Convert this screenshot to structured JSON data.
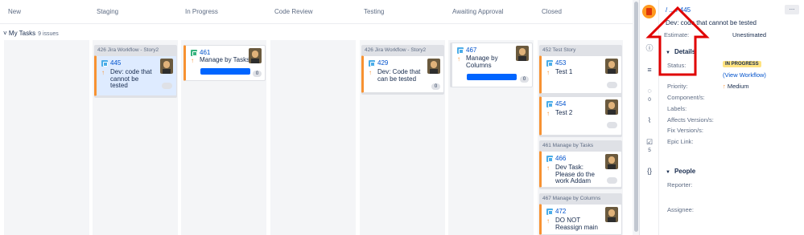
{
  "columns": [
    "New",
    "Staging",
    "In Progress",
    "Code Review",
    "Testing",
    "Awaiting Approval",
    "Closed"
  ],
  "swimlane": {
    "label": "My Tasks",
    "count": "9 issues"
  },
  "parents": {
    "staging": "426  Jira Workflow - Story2",
    "testing": "426  Jira Workflow - Story2",
    "closed_1": "452  Test Story",
    "closed_2": "461  Manage by Tasks",
    "closed_3": "467  Manage by Columns"
  },
  "cards": {
    "c445": {
      "key": "445",
      "summary_1": "Dev: code that",
      "summary_2": "cannot be",
      "summary_3": "tested"
    },
    "c461": {
      "key": "461",
      "summary_1": "Manage by Tasks",
      "badge": "0"
    },
    "c429": {
      "key": "429",
      "summary_1": "Dev: Code that",
      "summary_2": "can be tested",
      "badge": "0"
    },
    "c467": {
      "key": "467",
      "summary_1": "Manage by",
      "summary_2": "Columns",
      "badge": "0"
    },
    "c453": {
      "key": "453",
      "summary_1": "Test 1"
    },
    "c454": {
      "key": "454",
      "summary_1": "Test 2"
    },
    "c466": {
      "key": "466",
      "summary_1": "Dev Task:",
      "summary_2": "Please do the",
      "summary_3": "work Addam"
    },
    "c472": {
      "key": "472",
      "summary_1": "DO NOT",
      "summary_2": "Reassign main"
    }
  },
  "detail": {
    "breadcrumb": "/ ... / 445",
    "title": "Dev: code that cannot be tested",
    "more": "...",
    "estimate_label": "Estimate:",
    "estimate_value": "Unestimated",
    "details_header": "Details",
    "status_label": "Status:",
    "status_value": "IN PROGRESS",
    "view_workflow": "(View Workflow)",
    "priority_label": "Priority:",
    "priority_value": "Medium",
    "components_label": "Component/s:",
    "labels_label": "Labels:",
    "affects_label": "Affects Version/s:",
    "fix_label": "Fix Version/s:",
    "epic_label": "Epic Link:",
    "people_header": "People",
    "reporter_label": "Reporter:",
    "assignee_label": "Assignee:",
    "comments_count": "0",
    "subtasks_count": "5"
  },
  "colors": {
    "accent": "#0052cc",
    "annotation": "#e00000",
    "priority": "#f79232",
    "status": "#ffe380"
  }
}
